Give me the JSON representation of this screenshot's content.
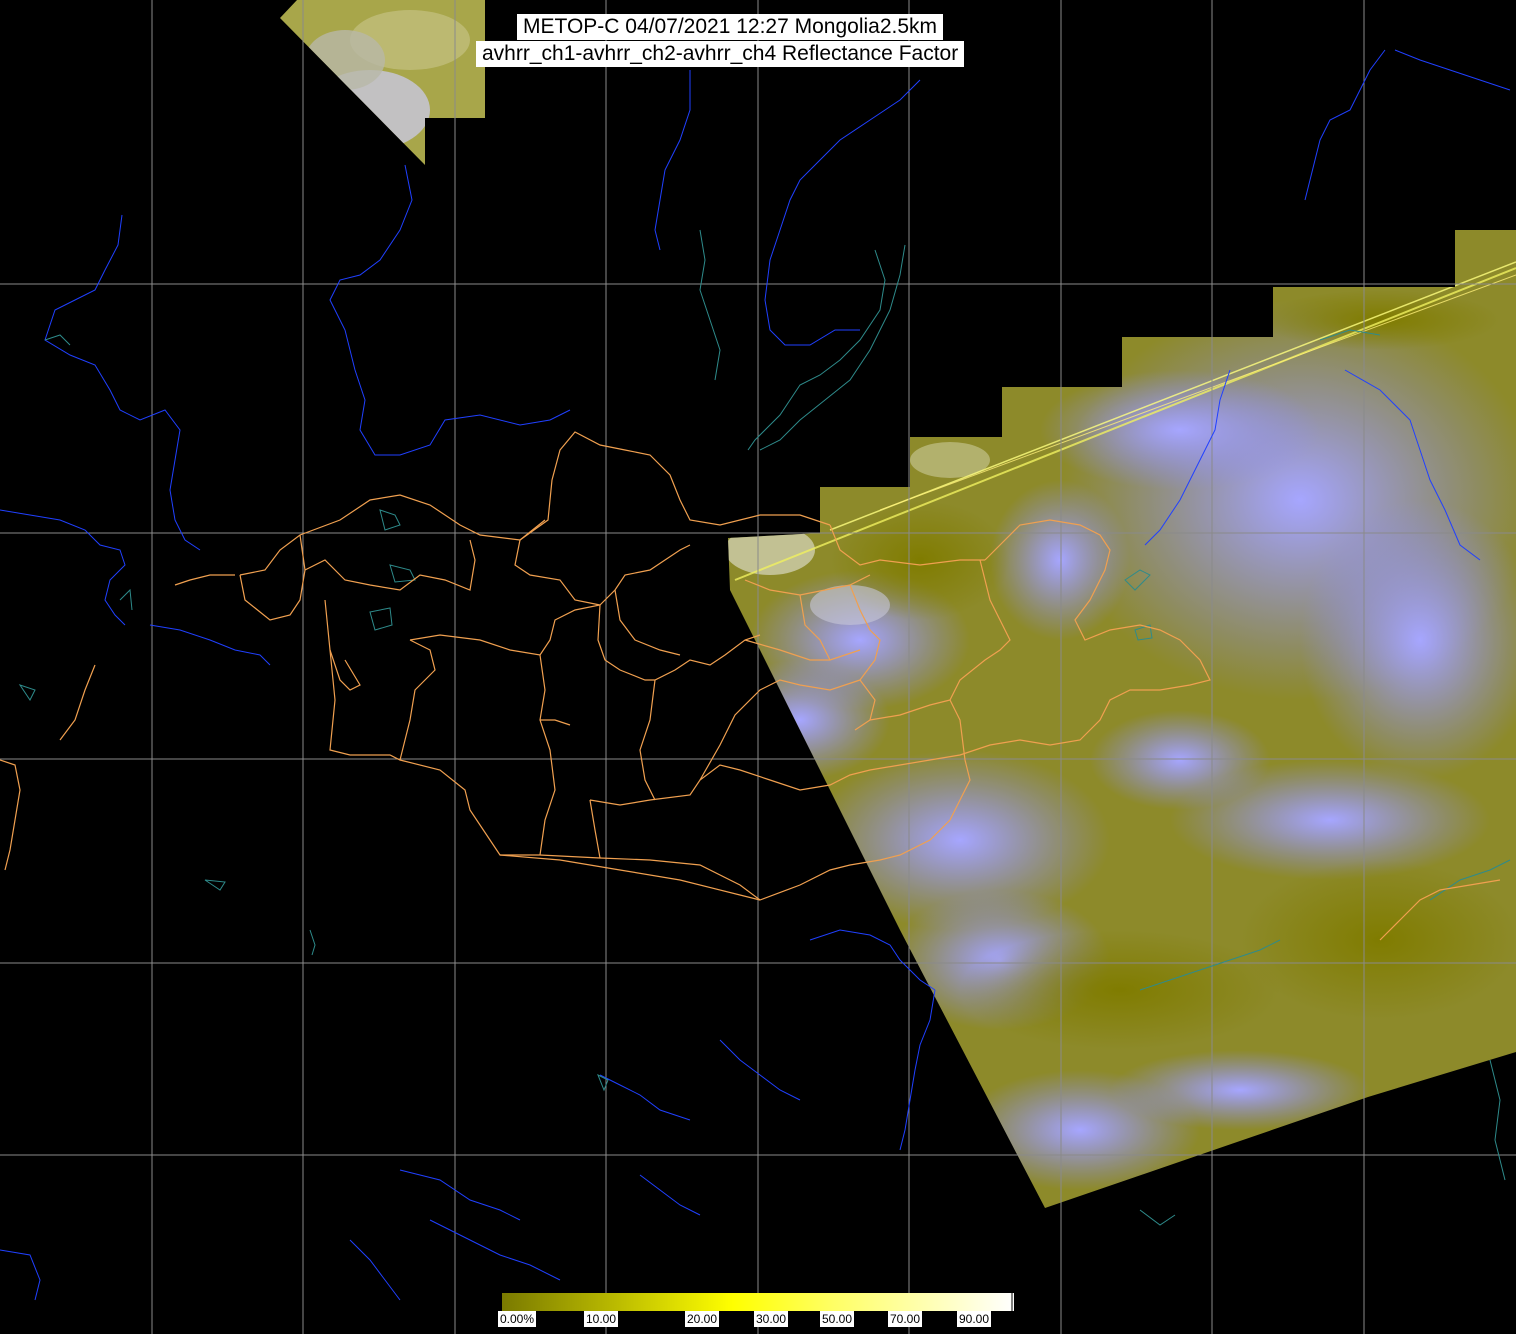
{
  "title": {
    "line1": "METOP-C 04/07/2021 12:27 Mongolia2.5km",
    "line2": "avhrr_ch1-avhrr_ch2-avhrr_ch4 Reflectance Factor"
  },
  "colorbar": {
    "labels": [
      "0.00%",
      "10.00",
      "20.00",
      "30.00",
      "50.00",
      "70.00",
      "90.00"
    ],
    "colors": [
      "#7a7a00",
      "#b4b400",
      "#ffff00",
      "#ffff66",
      "#ffffbb",
      "#ffffff"
    ]
  },
  "colors": {
    "background": "#000000",
    "grid": "#8a8a8a",
    "coastline": "#1e3cff",
    "lakes": "#2e8b8b",
    "admin_border": "#f0a050",
    "swath_cloud": "#8c8cff",
    "swath_ground": "#8c8c10"
  }
}
